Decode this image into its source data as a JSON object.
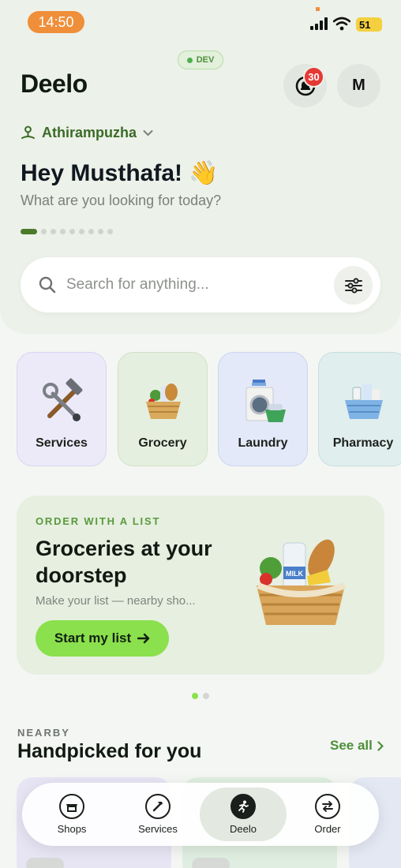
{
  "status_bar": {
    "time": "14:50",
    "battery": "51"
  },
  "header": {
    "dev_badge": "DEV",
    "brand": "Deelo",
    "notification_count": "30",
    "avatar_initial": "M",
    "location": "Athirampuzha",
    "greeting": "Hey Musthafa! 👋",
    "subgreeting": "What are you looking for today?"
  },
  "search": {
    "placeholder": "Search for anything..."
  },
  "categories": [
    {
      "label": "Services"
    },
    {
      "label": "Grocery"
    },
    {
      "label": "Laundry"
    },
    {
      "label": "Pharmacy"
    }
  ],
  "promo": {
    "eyebrow": "ORDER WITH A LIST",
    "title": "Groceries at your doorstep",
    "subtitle": "Make your list — nearby sho...",
    "button_label": "Start my list",
    "basket_label": "MILK"
  },
  "nearby": {
    "eyebrow": "NEARBY",
    "title": "Handpicked for you",
    "see_all": "See all"
  },
  "tabbar": {
    "tabs": [
      {
        "label": "Shops"
      },
      {
        "label": "Services"
      },
      {
        "label": "Deelo"
      },
      {
        "label": "Order"
      }
    ],
    "active": "Deelo"
  },
  "colors": {
    "accent_green": "#8be04d",
    "brand_green": "#4c8f3a",
    "badge_red": "#e53935",
    "time_pill": "#ef8f3a"
  }
}
